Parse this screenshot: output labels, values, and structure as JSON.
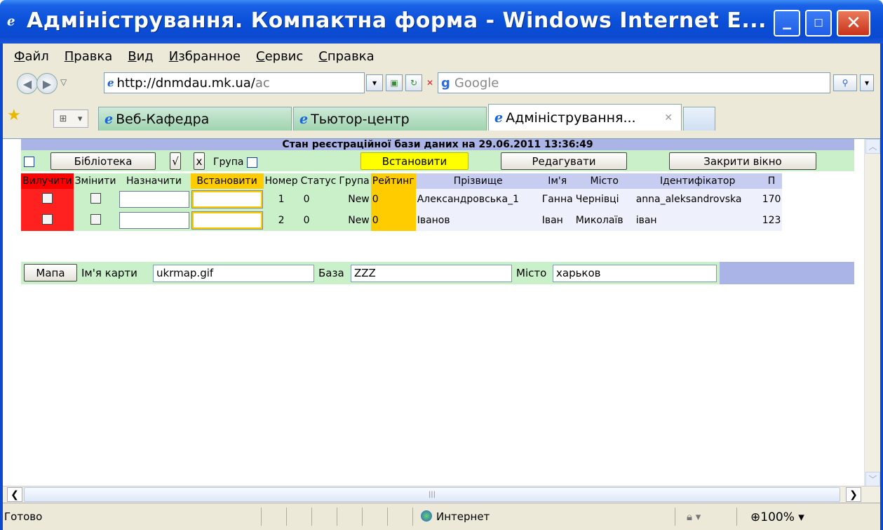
{
  "window": {
    "title": "Адміністрування. Компактна форма - Windows Internet E..."
  },
  "menu": [
    "Файл",
    "Правка",
    "Вид",
    "Избранное",
    "Сервис",
    "Справка"
  ],
  "address": {
    "url_host": "http://dnmdau.mk.ua/",
    "url_rest": "ac",
    "search_placeholder": "Google"
  },
  "tabs": [
    {
      "label": "Веб-Кафедра"
    },
    {
      "label": "Тьютор-центр"
    },
    {
      "label": "Адміністрування...",
      "active": true
    }
  ],
  "page": {
    "status_line": "Стан реєстраційної бази даних на  29.06.2011   13:36:49",
    "toolbar": {
      "library_label": "Бібліотека",
      "check_label": "√",
      "cross_label": "x",
      "group_label": "Група",
      "apply_label": "Встановити",
      "edit_label": "Редагувати",
      "close_label": "Закрити вікно"
    },
    "columns": [
      "Вилучити",
      "Змінити",
      "Назначити",
      "Встановити",
      "Номер",
      "Статус",
      "Група",
      "Рейтинг",
      "Прізвище",
      "Ім'я",
      "Місто",
      "Ідентифікатор",
      "П"
    ],
    "rows": [
      {
        "number": "1",
        "status": "0",
        "group": "New",
        "rating": "0",
        "surname": "Александровська_1",
        "name": "Ганна",
        "city": "Чернівці",
        "id": "anna_aleksandrovska",
        "extra": "170"
      },
      {
        "number": "2",
        "status": "0",
        "group": "New",
        "rating": "0",
        "surname": "Іванов",
        "name": "Іван",
        "city": "Миколаїв",
        "id": "іван",
        "extra": "123"
      }
    ],
    "map": {
      "button_label": "Мапа",
      "map_name_label": "Ім'я карти",
      "map_name_value": "ukrmap.gif",
      "base_label": "База",
      "base_value": "ZZZ",
      "city_label": "Місто",
      "city_value": "харьков"
    }
  },
  "statusbar": {
    "ready": "Готово",
    "zone": "Интернет",
    "zoom": "100%"
  }
}
